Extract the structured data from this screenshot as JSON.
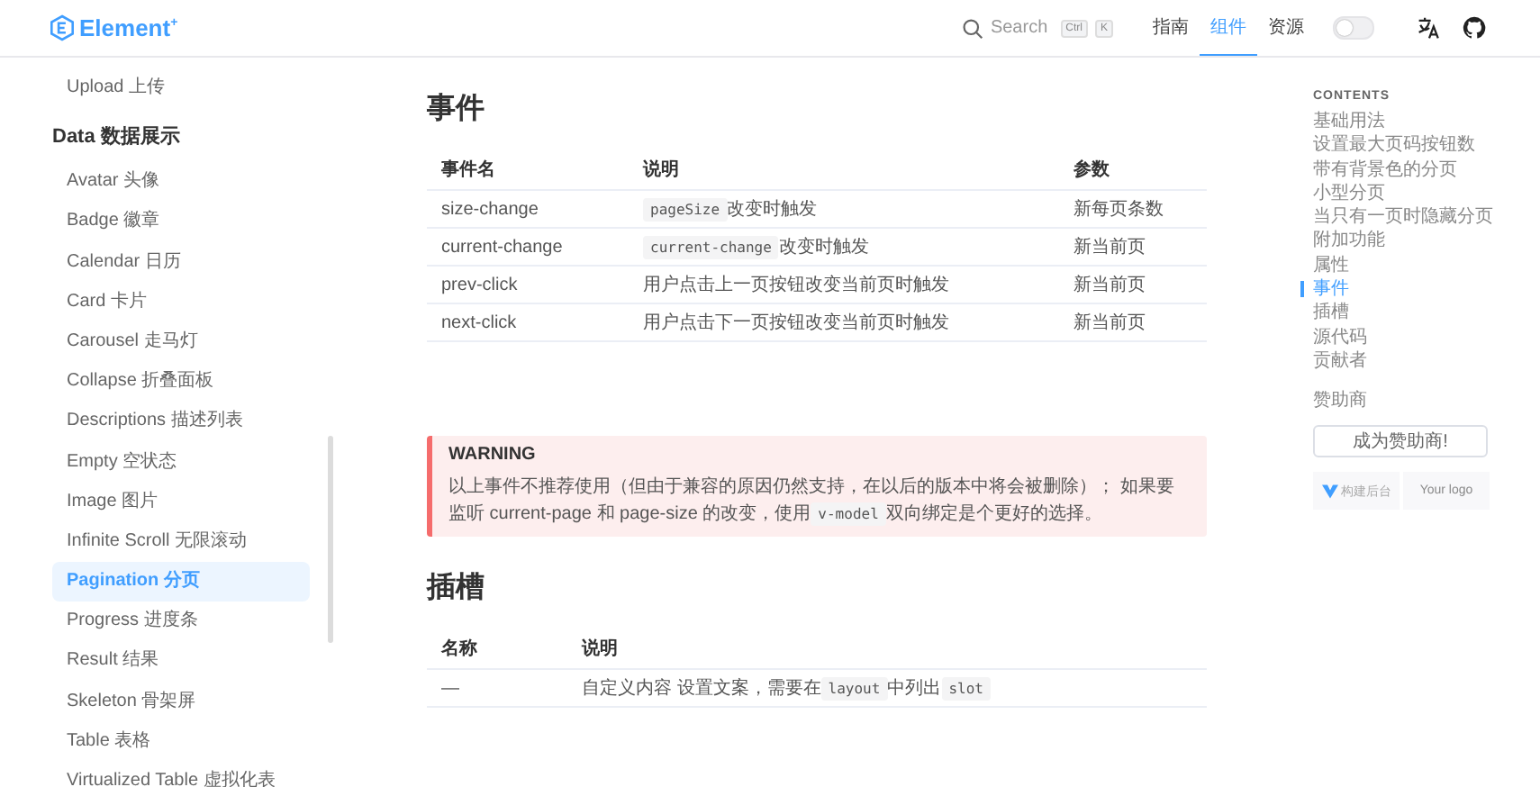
{
  "header": {
    "logo": "Element",
    "logo_mark": "+",
    "search": {
      "placeholder": "Search",
      "keys": [
        "Ctrl",
        "K"
      ]
    },
    "nav": [
      {
        "label": "指南",
        "selected": false
      },
      {
        "label": "组件",
        "selected": true
      },
      {
        "label": "资源",
        "selected": false
      }
    ],
    "dark_mode": {
      "on": false
    }
  },
  "sidebar": {
    "items": [
      {
        "kind": "item",
        "label": "Upload 上传",
        "selected": false
      },
      {
        "kind": "group",
        "label": "Data 数据展示"
      },
      {
        "kind": "item",
        "label": "Avatar 头像",
        "selected": false
      },
      {
        "kind": "item",
        "label": "Badge 徽章",
        "selected": false
      },
      {
        "kind": "item",
        "label": "Calendar 日历",
        "selected": false
      },
      {
        "kind": "item",
        "label": "Card 卡片",
        "selected": false
      },
      {
        "kind": "item",
        "label": "Carousel 走马灯",
        "selected": false
      },
      {
        "kind": "item",
        "label": "Collapse 折叠面板",
        "selected": false
      },
      {
        "kind": "item",
        "label": "Descriptions 描述列表",
        "selected": false
      },
      {
        "kind": "item",
        "label": "Empty 空状态",
        "selected": false
      },
      {
        "kind": "item",
        "label": "Image 图片",
        "selected": false
      },
      {
        "kind": "item",
        "label": "Infinite Scroll 无限滚动",
        "selected": false
      },
      {
        "kind": "item",
        "label": "Pagination 分页",
        "selected": true
      },
      {
        "kind": "item",
        "label": "Progress 进度条",
        "selected": false
      },
      {
        "kind": "item",
        "label": "Result 结果",
        "selected": false
      },
      {
        "kind": "item",
        "label": "Skeleton 骨架屏",
        "selected": false
      },
      {
        "kind": "item",
        "label": "Table 表格",
        "selected": false
      },
      {
        "kind": "item",
        "label": "Virtualized Table 虚拟化表",
        "selected": false
      }
    ]
  },
  "events": {
    "title": "事件",
    "columns": [
      "事件名",
      "说明",
      "参数"
    ],
    "rows": [
      {
        "name": "size-change",
        "description": [
          {
            "kind": "code",
            "text": "pageSize"
          },
          {
            "kind": "text",
            "text": "改变时触发"
          }
        ],
        "params": "新每页条数"
      },
      {
        "name": "current-change",
        "description": [
          {
            "kind": "code",
            "text": "current-change"
          },
          {
            "kind": "text",
            "text": "改变时触发"
          }
        ],
        "params": "新当前页"
      },
      {
        "name": "prev-click",
        "description": [
          {
            "kind": "text",
            "text": "用户点击上一页按钮改变当前页时触发"
          }
        ],
        "params": "新当前页"
      },
      {
        "name": "next-click",
        "description": [
          {
            "kind": "text",
            "text": "用户点击下一页按钮改变当前页时触发"
          }
        ],
        "params": "新当前页"
      }
    ]
  },
  "warning": {
    "title": "WARNING",
    "body": [
      {
        "kind": "text",
        "text": "以上事件不推荐使用（但由于兼容的原因仍然支持，在以后的版本中将会被删除）； 如果要监听 current-page 和 page-size 的改变，使用"
      },
      {
        "kind": "code",
        "text": "v-model"
      },
      {
        "kind": "text",
        "text": "双向绑定是个更好的选择。"
      }
    ]
  },
  "slots": {
    "title": "插槽",
    "columns": [
      "名称",
      "说明"
    ],
    "rows": [
      {
        "name": "—",
        "description": [
          {
            "kind": "text",
            "text": "自定义内容 设置文案，需要在"
          },
          {
            "kind": "code",
            "text": "layout"
          },
          {
            "kind": "text",
            "text": "中列出"
          },
          {
            "kind": "code",
            "text": "slot"
          }
        ]
      }
    ]
  },
  "toc": {
    "title": "CONTENTS",
    "items": [
      {
        "label": "基础用法",
        "selected": false
      },
      {
        "label": "设置最大页码按钮数",
        "selected": false
      },
      {
        "label": "带有背景色的分页",
        "selected": false
      },
      {
        "label": "小型分页",
        "selected": false
      },
      {
        "label": "当只有一页时隐藏分页",
        "selected": false
      },
      {
        "label": "附加功能",
        "selected": false
      },
      {
        "label": "属性",
        "selected": false
      },
      {
        "label": "事件",
        "selected": true
      },
      {
        "label": "插槽",
        "selected": false
      },
      {
        "label": "源代码",
        "selected": false
      },
      {
        "label": "贡献者",
        "selected": false
      }
    ],
    "sponsor_title": "赞助商",
    "sponsor_button": "成为赞助商!",
    "sponsors": [
      {
        "kind": "brand",
        "label": "构建后台"
      },
      {
        "kind": "placeholder",
        "label": "Your logo"
      }
    ]
  }
}
